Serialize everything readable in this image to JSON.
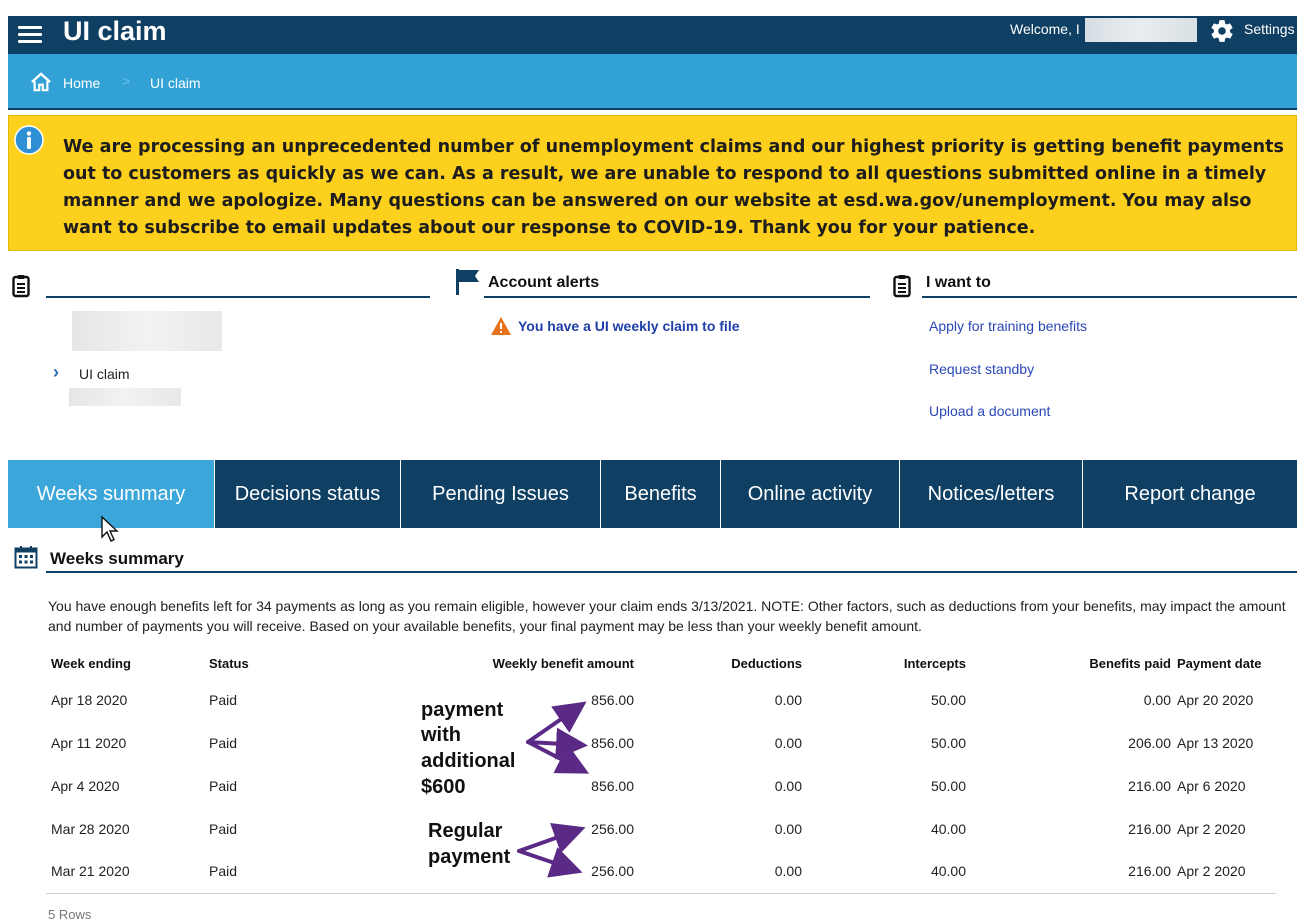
{
  "header": {
    "title": "UI claim",
    "welcome": "Welcome, I",
    "settings": "Settings"
  },
  "breadcrumb": {
    "home": "Home",
    "separator": ">",
    "current": "UI claim"
  },
  "banner": {
    "message": "We are processing an unprecedented number of unemployment claims and our highest priority is getting benefit payments out to customers as quickly as we can. As a result, we are unable to respond to all questions submitted online in a timely manner and we apologize. Many questions can be answered on our website at esd.wa.gov/unemployment. You may also want to subscribe to email updates about our response to COVID-19. Thank you for your patience."
  },
  "claims_panel": {
    "item": "UI claim"
  },
  "alerts_panel": {
    "title": "Account alerts",
    "alert": "You have a UI weekly claim to file"
  },
  "want_panel": {
    "title": "I want to",
    "links": [
      "Apply for training benefits",
      "Request standby",
      "Upload a document"
    ]
  },
  "tabs": [
    "Weeks summary",
    "Decisions status",
    "Pending Issues",
    "Benefits",
    "Online activity",
    "Notices/letters",
    "Report change"
  ],
  "weeks_summary": {
    "title": "Weeks summary",
    "note": "You have enough benefits left for 34 payments as long as you remain eligible, however your claim ends 3/13/2021. NOTE: Other factors, such as deductions from your benefits, may impact the amount and number of payments you will receive. Based on your available benefits, your final payment may be less than your weekly benefit amount.",
    "columns": [
      "Week ending",
      "Status",
      "Weekly benefit amount",
      "Deductions",
      "Intercepts",
      "Benefits paid",
      "Payment date"
    ],
    "rows": [
      [
        "Apr 18 2020",
        "Paid",
        "856.00",
        "0.00",
        "50.00",
        "0.00",
        "Apr 20 2020"
      ],
      [
        "Apr 11 2020",
        "Paid",
        "856.00",
        "0.00",
        "50.00",
        "206.00",
        "Apr 13 2020"
      ],
      [
        "Apr 4 2020",
        "Paid",
        "856.00",
        "0.00",
        "50.00",
        "216.00",
        "Apr 6 2020"
      ],
      [
        "Mar 28 2020",
        "Paid",
        "256.00",
        "0.00",
        "40.00",
        "216.00",
        "Apr 2 2020"
      ],
      [
        "Mar 21 2020",
        "Paid",
        "256.00",
        "0.00",
        "40.00",
        "216.00",
        "Apr 2 2020"
      ]
    ],
    "row_count": "5 Rows"
  },
  "annotations": {
    "extra_lines": [
      "payment",
      "with",
      "additional",
      "$600"
    ],
    "regular_lines": [
      "Regular",
      "payment"
    ]
  },
  "colors": {
    "navy": "#0f3f63",
    "sky": "#32a2d6",
    "banner_yellow": "#fdd01e",
    "link_blue": "#2a47b8",
    "arrow_purple": "#5b2a86"
  }
}
